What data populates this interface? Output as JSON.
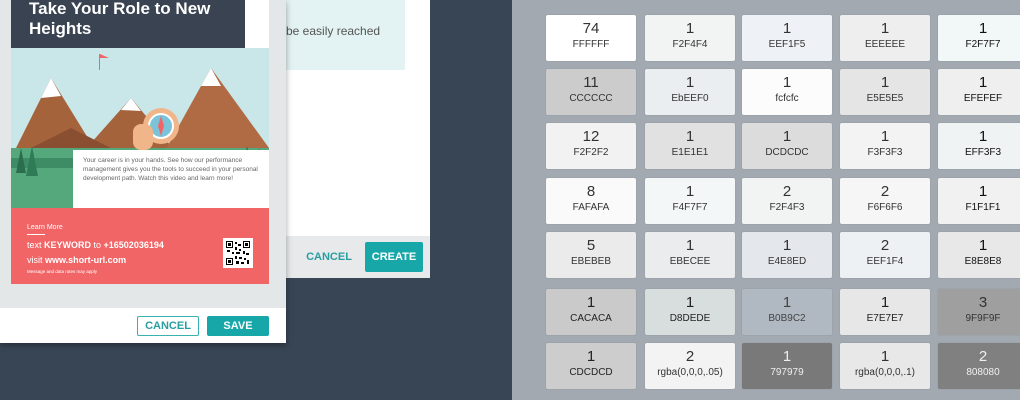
{
  "background_dialog": {
    "info_text": "be easily reached",
    "cancel_label": "CANCEL",
    "create_label": "CREATE"
  },
  "poster": {
    "title_line1": "Take Your Role to New",
    "title_line2": "Heights",
    "body_text": "Your career is in your hands. See how our performance management gives you the tools to succeed in your personal development path. Watch this video and learn more!",
    "learn_more": "Learn More",
    "text_prefix": "text ",
    "keyword": "KEYWORD",
    "to_word": " to ",
    "phone": "+16502036194",
    "visit_prefix": "visit ",
    "url": "www.short-url.com",
    "fine_print": "Message and data rates may apply"
  },
  "dialog": {
    "cancel_label": "CANCEL",
    "save_label": "SAVE"
  },
  "swatches": [
    [
      {
        "count": "74",
        "label": "FFFFFF",
        "bg": "#ffffff",
        "fg": "#333333"
      },
      {
        "count": "11",
        "label": "CCCCCC",
        "bg": "#cccccc",
        "fg": "#333333"
      },
      {
        "count": "12",
        "label": "F2F2F2",
        "bg": "#f2f2f2",
        "fg": "#333333"
      },
      {
        "count": "8",
        "label": "FAFAFA",
        "bg": "#fafafa",
        "fg": "#333333"
      },
      {
        "count": "5",
        "label": "EBEBEB",
        "bg": "#ebebeb",
        "fg": "#333333"
      },
      {
        "count": "1",
        "label": "CACACA",
        "bg": "#cacaca",
        "fg": "#222222"
      },
      {
        "count": "1",
        "label": "CDCDCD",
        "bg": "#cdcdcd",
        "fg": "#222222"
      }
    ],
    [
      {
        "count": "1",
        "label": "F2F4F4",
        "bg": "#f2f4f4",
        "fg": "#333333"
      },
      {
        "count": "1",
        "label": "EbEEF0",
        "bg": "#ebeef0",
        "fg": "#333333"
      },
      {
        "count": "1",
        "label": "E1E1E1",
        "bg": "#e1e1e1",
        "fg": "#333333"
      },
      {
        "count": "1",
        "label": "F4F7F7",
        "bg": "#f4f7f7",
        "fg": "#333333"
      },
      {
        "count": "1",
        "label": "EBECEE",
        "bg": "#ebecee",
        "fg": "#333333"
      },
      {
        "count": "1",
        "label": "D8DEDE",
        "bg": "#d8dede",
        "fg": "#222222"
      },
      {
        "count": "2",
        "label": "rgba(0,0,0,.05)",
        "bg": "#f3f3f3",
        "fg": "#333333"
      }
    ],
    [
      {
        "count": "1",
        "label": "EEF1F5",
        "bg": "#eef1f5",
        "fg": "#333333"
      },
      {
        "count": "1",
        "label": "fcfcfc",
        "bg": "#fcfcfc",
        "fg": "#333333"
      },
      {
        "count": "1",
        "label": "DCDCDC",
        "bg": "#dcdcdc",
        "fg": "#333333"
      },
      {
        "count": "2",
        "label": "F2F4F3",
        "bg": "#f2f4f3",
        "fg": "#333333"
      },
      {
        "count": "1",
        "label": "E4E8ED",
        "bg": "#e4e8ed",
        "fg": "#333333"
      },
      {
        "count": "1",
        "label": "B0B9C2",
        "bg": "#b0b9c2",
        "fg": "#444444"
      },
      {
        "count": "1",
        "label": "797979",
        "bg": "#797979",
        "fg": "#eeeeee"
      }
    ],
    [
      {
        "count": "1",
        "label": "EEEEEE",
        "bg": "#eeeeee",
        "fg": "#333333"
      },
      {
        "count": "1",
        "label": "E5E5E5",
        "bg": "#e5e5e5",
        "fg": "#333333"
      },
      {
        "count": "1",
        "label": "F3F3F3",
        "bg": "#f3f3f3",
        "fg": "#333333"
      },
      {
        "count": "2",
        "label": "F6F6F6",
        "bg": "#f6f6f6",
        "fg": "#333333"
      },
      {
        "count": "2",
        "label": "EEF1F4",
        "bg": "#eef1f4",
        "fg": "#333333"
      },
      {
        "count": "1",
        "label": "E7E7E7",
        "bg": "#e7e7e7",
        "fg": "#222222"
      },
      {
        "count": "1",
        "label": "rgba(0,0,0,.1)",
        "bg": "#e8e8e8",
        "fg": "#333333"
      }
    ],
    [
      {
        "count": "1",
        "label": "F2F7F7",
        "bg": "#f2f7f7",
        "fg": "#111111"
      },
      {
        "count": "1",
        "label": "EFEFEF",
        "bg": "#efefef",
        "fg": "#111111"
      },
      {
        "count": "1",
        "label": "EFF3F3",
        "bg": "#eff3f3",
        "fg": "#111111"
      },
      {
        "count": "1",
        "label": "F1F1F1",
        "bg": "#f1f1f1",
        "fg": "#111111"
      },
      {
        "count": "1",
        "label": "E8E8E8",
        "bg": "#e8e8e8",
        "fg": "#111111"
      },
      {
        "count": "3",
        "label": "9F9F9F",
        "bg": "#9f9f9f",
        "fg": "#333333"
      },
      {
        "count": "2",
        "label": "808080",
        "bg": "#808080",
        "fg": "#f0f0f0"
      }
    ]
  ]
}
